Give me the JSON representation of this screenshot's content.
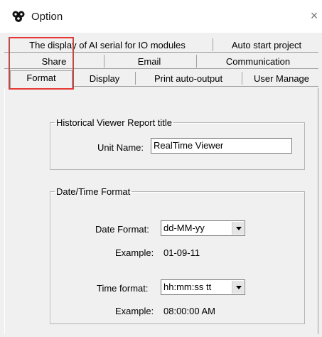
{
  "window": {
    "title": "Option",
    "close_glyph": "×",
    "icon": "app-icon"
  },
  "tabs": {
    "row1": [
      {
        "label": "The display of AI serial for IO modules"
      },
      {
        "label": "Auto start project"
      }
    ],
    "row2": [
      {
        "label": "Share"
      },
      {
        "label": "Email"
      },
      {
        "label": "Communication"
      }
    ],
    "row3": [
      {
        "label": "Format",
        "active": true
      },
      {
        "label": "Display"
      },
      {
        "label": "Print auto-output"
      },
      {
        "label": "User Manage"
      }
    ],
    "highlight_color": "#e53935"
  },
  "report_title_group": {
    "legend": "Historical Viewer Report title",
    "unit_name_label": "Unit Name:",
    "unit_name_value": "RealTime Viewer"
  },
  "datetime_group": {
    "legend": "Date/Time Format",
    "date_format_label": "Date Format:",
    "date_format_value": "dd-MM-yy",
    "date_example_label": "Example:",
    "date_example_value": "01-09-11",
    "time_format_label": "Time format:",
    "time_format_value": "hh:mm:ss tt",
    "time_example_label": "Example:",
    "time_example_value": "08:00:00 AM"
  }
}
